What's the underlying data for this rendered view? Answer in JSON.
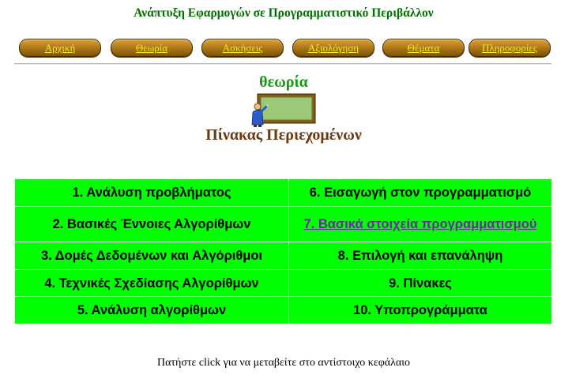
{
  "site": {
    "title": "Ανάπτυξη Εφαρμογών σε Προγραμματιστικό Περιβάλλον"
  },
  "nav": {
    "items": [
      {
        "label": "Αρχική"
      },
      {
        "label": "Θεωρία"
      },
      {
        "label": "Ασκήσεις"
      },
      {
        "label": "Αξιολόγηση"
      },
      {
        "label": "Θέματα"
      },
      {
        "label": "Πληροφορίες"
      }
    ]
  },
  "section": {
    "title": "θεωρία",
    "icon": "teacher-blackboard-icon"
  },
  "toc": {
    "title": "Πίνακας Περιεχομένων",
    "chapters": [
      {
        "label": "1. Ανάλυση προβλήματος"
      },
      {
        "label": "2. Βασικές Έννοιες Αλγορίθμων"
      },
      {
        "label": "3. Δομές Δεδομένων και Αλγόριθμοι"
      },
      {
        "label": "4. Τεχνικές Σχεδίασης Αλγορίθμων"
      },
      {
        "label": "5. Ανάλυση αλγορίθμων"
      },
      {
        "label": "6. Εισαγωγή στον προγραμματισμό"
      },
      {
        "label": "7. Βασικά στοιχεία προγραμματισμού"
      },
      {
        "label": "8. Επιλογή και επανάληψη"
      },
      {
        "label": "9. Πίνακες"
      },
      {
        "label": "10. Υποπρογράμματα"
      }
    ]
  },
  "footer": {
    "instruction": "Πατήστε click για να μεταβείτε στο αντίστοιχο κεφάλαιο"
  },
  "colors": {
    "site_title": "#006f00",
    "nav_button": "#b37b1a",
    "nav_text": "#f0ec2a",
    "section_title": "#159a15",
    "toc_title": "#6b3a12",
    "table_bg": "#00ff00",
    "link_visited": "#6a2aa0"
  }
}
